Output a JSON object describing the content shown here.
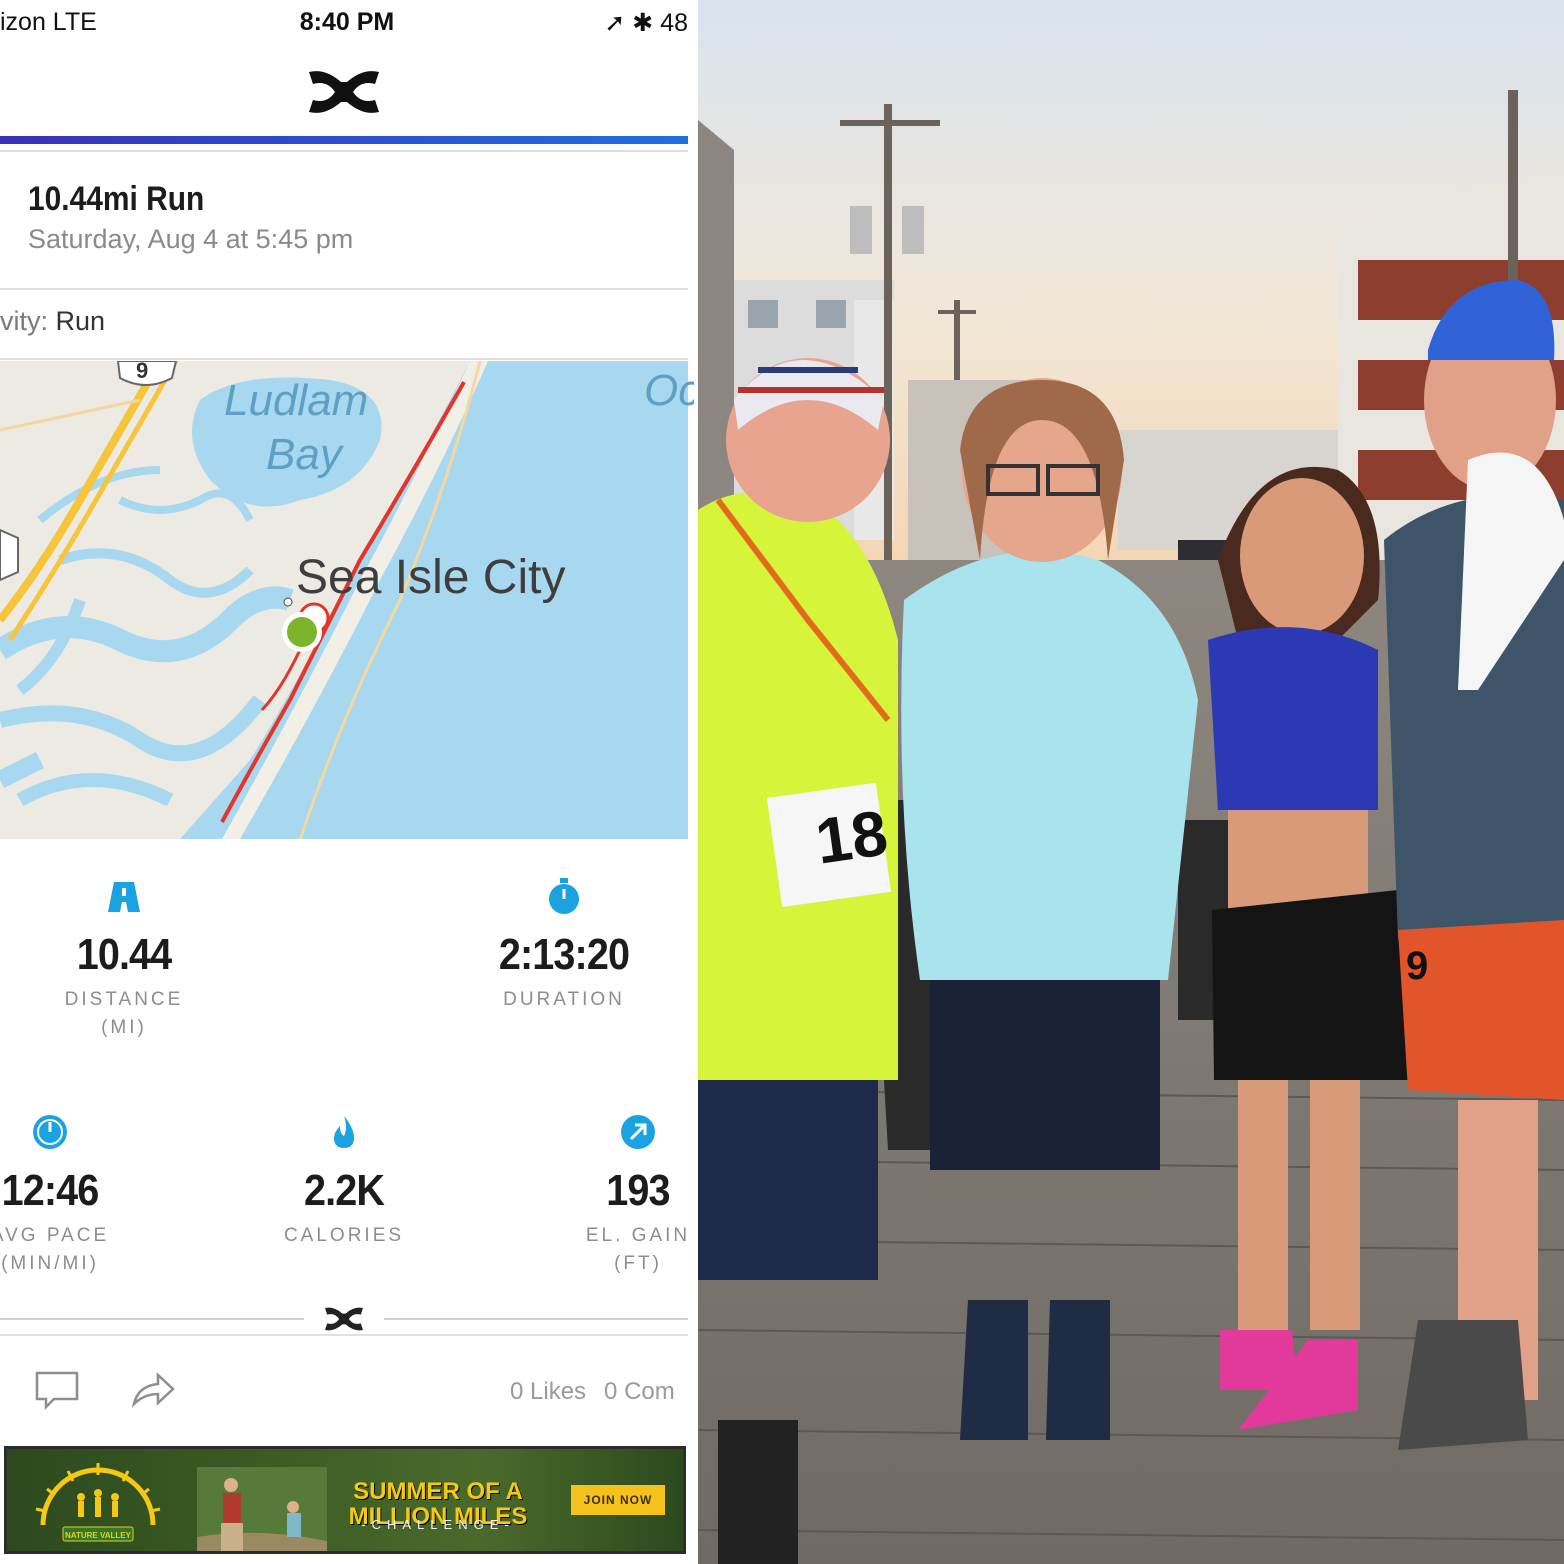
{
  "status_bar": {
    "carrier": "izon  LTE",
    "time": "8:40 PM",
    "right_status": "➚ ✱ 48"
  },
  "colors": {
    "accent_start": "#3a2fb8",
    "accent_end": "#1e6fe0",
    "route": "#e2352c",
    "start_marker": "#7cb52b",
    "icon_blue": "#1aa3e0",
    "ad_yellow": "#f5c816"
  },
  "workout": {
    "title": "10.44mi Run",
    "date": "Saturday, Aug 4 at 5:45 pm",
    "activity_label": "vity:",
    "activity_value": "Run"
  },
  "map": {
    "labels": {
      "bay_line1": "Ludlam",
      "bay_line2": "Bay",
      "ocean": "Oc",
      "city": "Sea Isle City",
      "route_shield": "9"
    }
  },
  "stats": [
    {
      "icon": "road-icon",
      "value": "10.44",
      "label_line1": "DISTANCE",
      "label_line2": "(MI)"
    },
    {
      "icon": "stopwatch-icon",
      "value": "2:13:20",
      "label_line1": "DURATION",
      "label_line2": ""
    },
    {
      "icon": "pace-gauge-icon",
      "value": "12:46",
      "label_line1": "AVG PACE",
      "label_line2": "(MIN/MI)"
    },
    {
      "icon": "flame-icon",
      "value": "2.2K",
      "label_line1": "CALORIES",
      "label_line2": ""
    },
    {
      "icon": "elevation-arrow-icon",
      "value": "193",
      "label_line1": "EL. GAIN",
      "label_line2": "(FT)"
    }
  ],
  "social": {
    "likes": "0 Likes",
    "comments": "0 Com"
  },
  "ad": {
    "headline_line1": "SUMMER OF A",
    "headline_line2": "MILLION MILES",
    "subline": "-CHALLENGE-",
    "cta": "JOIN NOW",
    "brand": "NATURE VALLEY"
  },
  "photo": {
    "bib_number": "18",
    "bib_partial": "9"
  }
}
